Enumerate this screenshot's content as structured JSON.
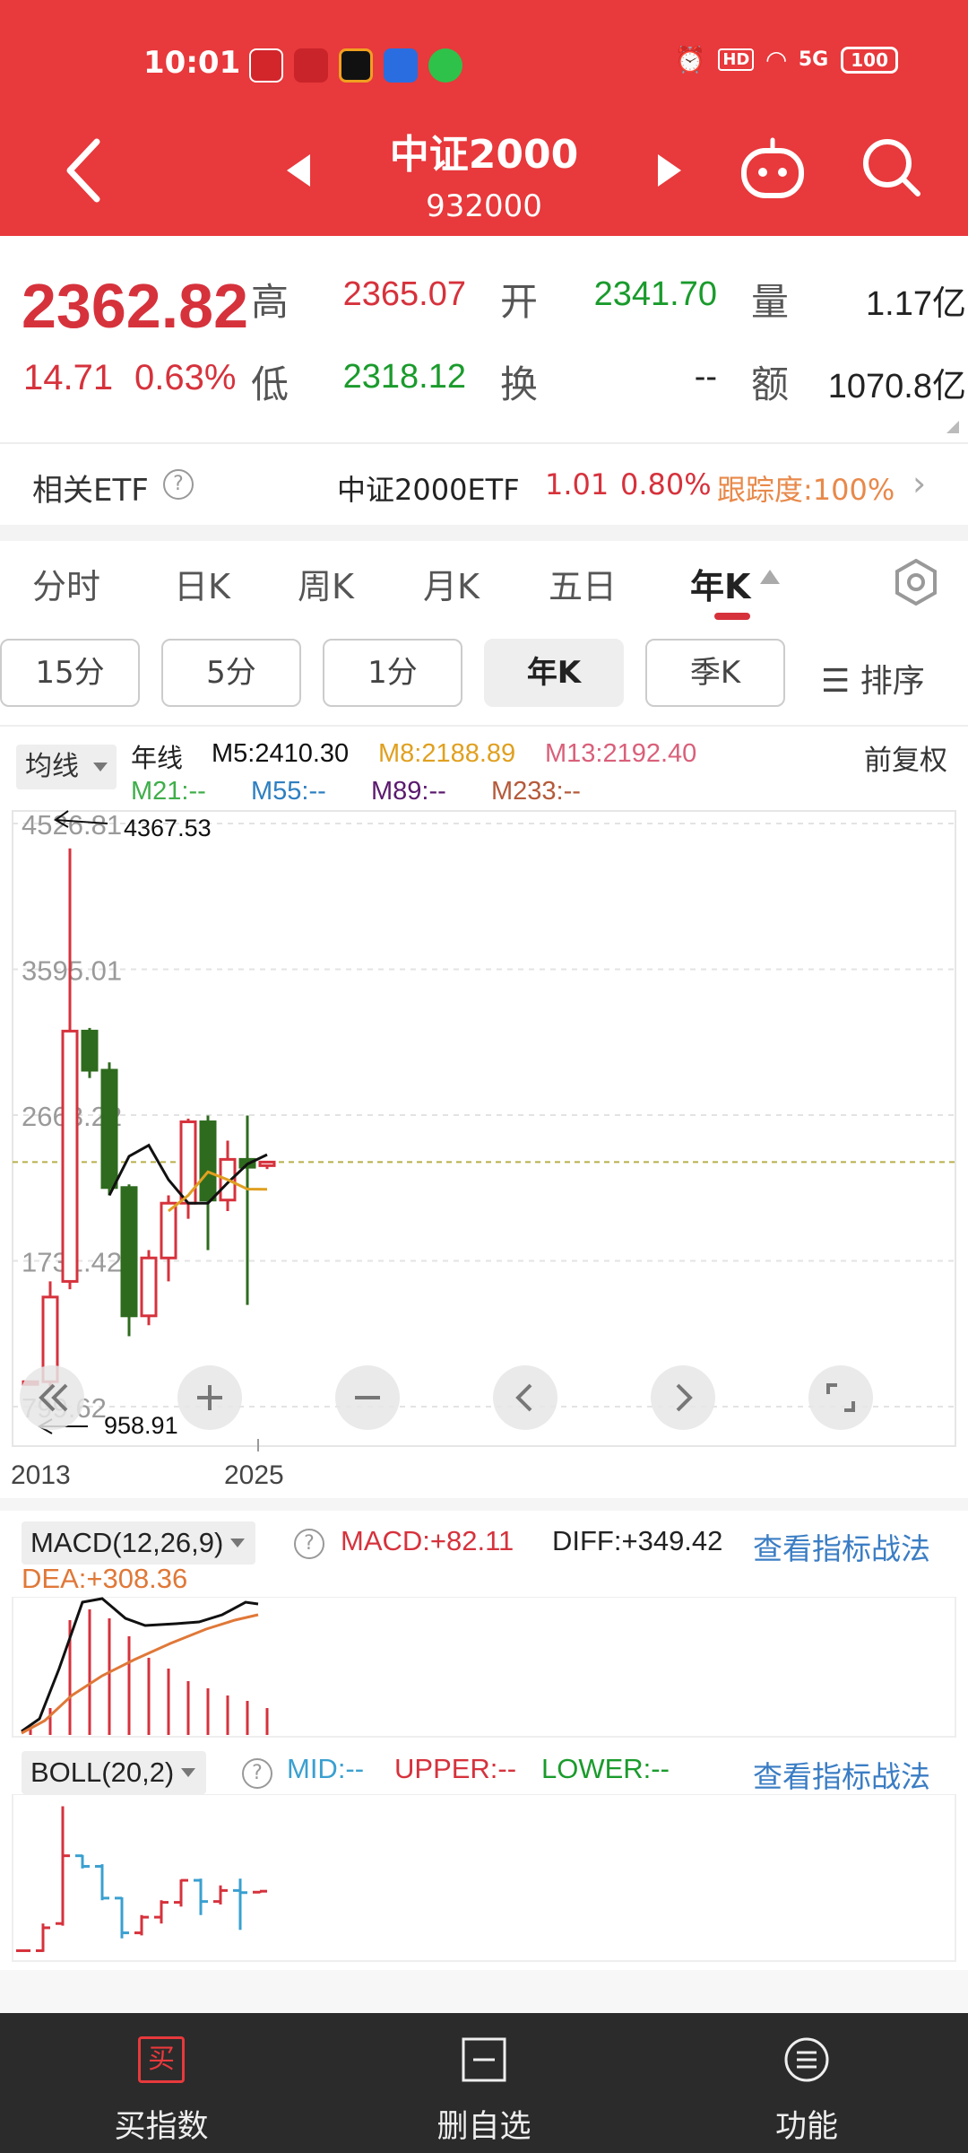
{
  "status_bar": {
    "time": "10:01",
    "network": "5G",
    "hd": "HD",
    "battery": "100"
  },
  "header": {
    "title": "中证2000",
    "code": "932000"
  },
  "quote": {
    "price": "2362.82",
    "change": "14.71",
    "change_pct": "0.63%",
    "high_label": "高",
    "high": "2365.07",
    "open_label": "开",
    "open": "2341.70",
    "volume_label": "量",
    "volume": "1.17亿",
    "low_label": "低",
    "low": "2318.12",
    "turnover_label": "换",
    "turnover": "--",
    "amount_label": "额",
    "amount": "1070.8亿"
  },
  "etf": {
    "label": "相关ETF",
    "name": "中证2000ETF",
    "price": "1.01",
    "pct": "0.80%",
    "tracking": "跟踪度:100%"
  },
  "tabs": [
    {
      "label": "分时"
    },
    {
      "label": "日K"
    },
    {
      "label": "周K"
    },
    {
      "label": "月K"
    },
    {
      "label": "五日"
    },
    {
      "label": "年K"
    }
  ],
  "periods": [
    {
      "label": "15分"
    },
    {
      "label": "5分"
    },
    {
      "label": "1分"
    },
    {
      "label": "年K"
    },
    {
      "label": "季K"
    }
  ],
  "sort_label": "☰ 排序",
  "ma": {
    "selector": "均线",
    "line_name": "年线",
    "m5": "M5:2410.30",
    "m8": "M8:2188.89",
    "m13": "M13:2192.40",
    "m21": "M21:--",
    "m55": "M55:--",
    "m89": "M89:--",
    "m233": "M233:--",
    "adjust": "前复权"
  },
  "colors": {
    "up": "#d6323c",
    "down": "#2e6b1e",
    "m5": "#111111",
    "m8": "#e0a020",
    "m13": "#d9607a",
    "macd_accent": "#e07838",
    "boll_blue": "#3aa0d0"
  },
  "chart_data": {
    "type": "candlestick",
    "x_range": [
      "2013",
      "2025"
    ],
    "y_axis_labels": [
      "4526.81",
      "3595.01",
      "2663.22",
      "1731.42",
      "799.62"
    ],
    "max_marker": "4367.53",
    "min_marker": "958.91",
    "current_price": 2362.82,
    "candles": [
      {
        "open": 958.91,
        "close": 958.91,
        "high": 958.91,
        "low": 958.91
      },
      {
        "open": 958.91,
        "close": 1500,
        "high": 1600,
        "low": 930
      },
      {
        "open": 1600,
        "close": 3200,
        "high": 4367.53,
        "low": 1550
      },
      {
        "open": 3200,
        "close": 2950,
        "high": 3220,
        "low": 2900
      },
      {
        "open": 2950,
        "close": 2200,
        "high": 3000,
        "low": 2150
      },
      {
        "open": 2200,
        "close": 1380,
        "high": 2220,
        "low": 1250
      },
      {
        "open": 1380,
        "close": 1750,
        "high": 1800,
        "low": 1320
      },
      {
        "open": 1750,
        "close": 2100,
        "high": 2150,
        "low": 1600
      },
      {
        "open": 2100,
        "close": 2620,
        "high": 2640,
        "low": 2000
      },
      {
        "open": 2620,
        "close": 2120,
        "high": 2660,
        "low": 1800
      },
      {
        "open": 2120,
        "close": 2380,
        "high": 2500,
        "low": 2050
      },
      {
        "open": 2380,
        "close": 2330,
        "high": 2660,
        "low": 1450
      },
      {
        "open": 2340,
        "close": 2362.82,
        "high": 2365.07,
        "low": 2318.12
      }
    ],
    "m5": [
      null,
      null,
      null,
      null,
      2150,
      2400,
      2470,
      2250,
      2100,
      2100,
      2230,
      2350,
      2410.3
    ],
    "m8": [
      null,
      null,
      null,
      null,
      null,
      null,
      null,
      2050,
      2150,
      2300,
      2250,
      2190,
      2188.89
    ]
  },
  "axis": {
    "year_start": "2013",
    "year_end": "2025"
  },
  "macd": {
    "selector": "MACD(12,26,9)",
    "macd": "MACD:+82.11",
    "diff": "DIFF:+349.42",
    "dea": "DEA:+308.36",
    "link": "查看指标战法"
  },
  "boll": {
    "selector": "BOLL(20,2)",
    "mid": "MID:--",
    "upper": "UPPER:--",
    "lower": "LOWER:--",
    "link": "查看指标战法"
  },
  "bottom": {
    "buy": "买指数",
    "buy_icon_text": "买",
    "remove": "删自选",
    "more": "功能"
  }
}
